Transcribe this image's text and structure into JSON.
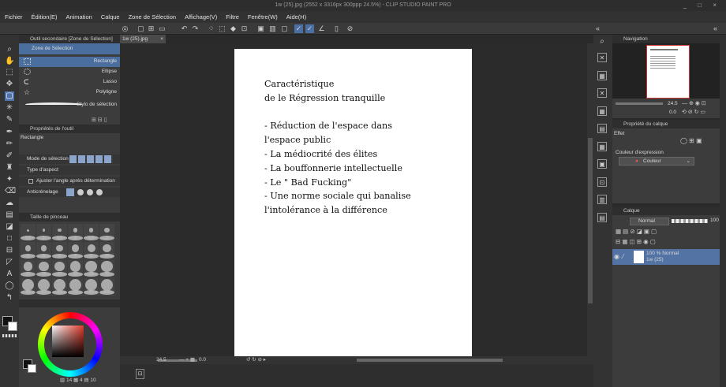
{
  "window": {
    "title": "1w (25).jpg (2552 x 3316px 300ppp 24.5%) - CLIP STUDIO PAINT PRO",
    "controls": "_ □ ×"
  },
  "menu": [
    "Fichier",
    "Édition(E)",
    "Animation",
    "Calque",
    "Zone de Sélection",
    "Affichage(V)",
    "Filtre",
    "Fenêtre(W)",
    "Aide(H)"
  ],
  "subtool": {
    "header": "Outil secondaire [Zone de Sélection]",
    "tab": "Zone de Sélection",
    "items": [
      "Rectangle",
      "Ellipse",
      "Lasso",
      "Polyligne",
      "Stylo de sélection"
    ]
  },
  "props": {
    "header": "Propriétés de l'outil",
    "name": "Rectangle",
    "mode_label": "Mode de sélection",
    "aspect_label": "Type d'aspect",
    "adjust_label": "Ajuster l'angle après détermination",
    "aa_label": "Anticrénelage"
  },
  "brush": {
    "header": "Taille de pinceau",
    "sizes": [
      "0.7",
      "1",
      "1.5",
      "2",
      "2.5",
      "3",
      "4",
      "5",
      "6",
      "7",
      "8",
      "10",
      "12",
      "15",
      "17",
      "20",
      "25",
      "30",
      "40",
      "50",
      "60",
      "70",
      "80",
      "100"
    ]
  },
  "colorinfo": {
    "a": "14",
    "b": "4",
    "c": "10"
  },
  "doctab": {
    "label": "1w (25).jpg",
    "close": "×"
  },
  "document": {
    "lines": [
      "Caractéristique",
      "de le Régression tranquille",
      "",
      "- Réduction de l'espace dans",
      "l'espace public",
      "- La médiocrité des élites",
      "- La bouffonnerie intellectuelle",
      "- Le \" Bad Fucking\"",
      "- Une norme sociale qui banalise",
      "l'intolérance à la différence"
    ]
  },
  "statusbar": {
    "zoom": "24.5",
    "angle": "0.0"
  },
  "navigator": {
    "header": "Navigation",
    "zoom": "24.5",
    "angle": "0.0"
  },
  "propsubview": {
    "header": "Propriété du calque",
    "effet": "Effet",
    "expr_label": "Couleur d'expression",
    "expr_value": "Couleur"
  },
  "layers": {
    "header": "Calque",
    "blend": "Normal",
    "opacity": "100",
    "item_line1": "100 % Normal",
    "item_line2": "1w (25)"
  }
}
